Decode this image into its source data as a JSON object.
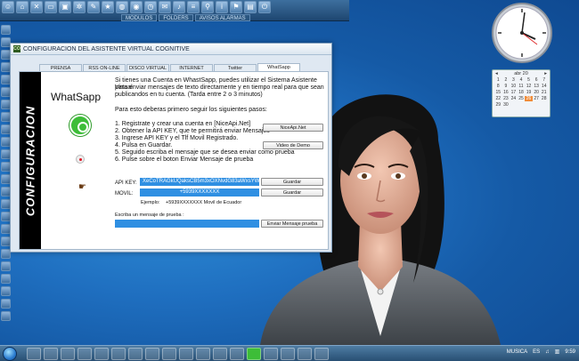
{
  "top_toolbar": {
    "tabs": [
      "MODULOS",
      "FOLDERS",
      "AVISOS ALARMAS"
    ]
  },
  "window": {
    "title": "CONFIGURACION DEL ASISTENTE VIRTUAL COGNITIVE",
    "tabs": [
      "PRENSA",
      "RSS ON-LINE",
      "DISCO VIRTUAL",
      "INTERNET",
      "Twitter",
      "WhatSapp"
    ],
    "active_tab": "WhatSapp",
    "side_label": "CONFIGURACION",
    "heading": "WhatSapp",
    "intro": [
      "Si tienes una Cuenta en WhastSapp, puedes utilizar el Sistema Asistente Virtual",
      "para enviar mensajes de texto directamente y en  tiempo real para que sean",
      "publicandos en tu cuenta. (Tarda entre 2 o 3 minutos)"
    ],
    "steps_intro": "Para esto deberas primero seguir los siguientes pasos:",
    "steps": [
      "1.  Registrate y crear una cuenta en [NiceApi.Net]",
      "2.  Obtener la API KEY, que te permitirá enviar Mensajes",
      "3.  Ingrese API KEY y el Tlf Movil Registrado.",
      "4.  Pulsa en Guardar.",
      "5.  Seguido escriba el mensaje que se desea enviar como prueba",
      "6.  Pulse sobre el boton Enviar Mensaje de prueba"
    ],
    "buttons": {
      "niceapi": "NiceApi.Net",
      "video": "Video de Demo",
      "guardar_api": "Guardar",
      "guardar_movil": "Guardar",
      "enviar": "Enviar Mensaje prueba"
    },
    "api_key_label": "API KEY:",
    "api_key_value": "XeCoTRAGkUQaksCB5m3xOXNvdG83aWxsYW",
    "movil_label": "MOVIL:",
    "movil_value": "+5939XXXXXXX",
    "example_label": "Ejemplo:",
    "example_value": "+5939XXXXXXX    Movil de Ecuador",
    "message_label": "Escriba un mensaje de prueba :",
    "message_value": ""
  },
  "calendar": {
    "month": "abr 20",
    "days": [
      "1",
      "2",
      "3",
      "4",
      "5",
      "6",
      "7",
      "8",
      "9",
      "10",
      "11",
      "12",
      "13",
      "14",
      "15",
      "16",
      "17",
      "18",
      "19",
      "20",
      "21",
      "22",
      "23",
      "24",
      "25",
      "26",
      "27",
      "28",
      "29",
      "30"
    ],
    "today": "26"
  },
  "taskbar": {
    "music": "MUSICA",
    "lang": "ES",
    "time": "9:59"
  },
  "colors": {
    "accent": "#2f8fe2",
    "desktop": "#1f6fc0",
    "whatsapp": "#3dbd38"
  }
}
